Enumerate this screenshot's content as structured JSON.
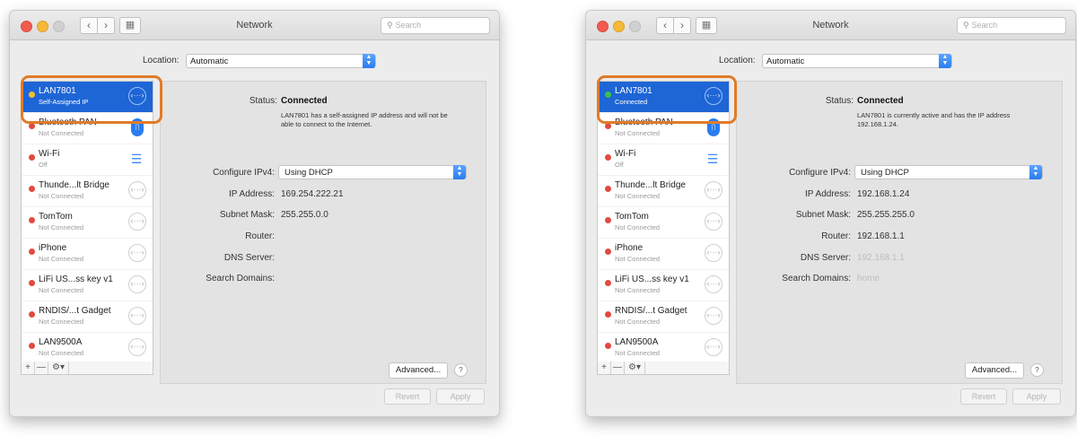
{
  "windows": [
    {
      "title": "Network",
      "search_placeholder": "Search",
      "location_label": "Location:",
      "location_value": "Automatic",
      "services": [
        {
          "name": "LAN7801",
          "status": "Self-Assigned IP",
          "dot": "yellow",
          "icon": "ethernet-icon"
        },
        {
          "name": "Bluetooth PAN",
          "status": "Not Connected",
          "dot": "red",
          "icon": "bluetooth-icon"
        },
        {
          "name": "Wi-Fi",
          "status": "Off",
          "dot": "red",
          "icon": "wifi-icon"
        },
        {
          "name": "Thunde...lt Bridge",
          "status": "Not Connected",
          "dot": "red",
          "icon": "ethernet-icon"
        },
        {
          "name": "TomTom",
          "status": "Not Connected",
          "dot": "red",
          "icon": "ethernet-icon"
        },
        {
          "name": "iPhone",
          "status": "Not Connected",
          "dot": "red",
          "icon": "ethernet-icon"
        },
        {
          "name": "LiFi US...ss key v1",
          "status": "Not Connected",
          "dot": "red",
          "icon": "ethernet-icon"
        },
        {
          "name": "RNDIS/...t Gadget",
          "status": "Not Connected",
          "dot": "red",
          "icon": "ethernet-icon"
        },
        {
          "name": "LAN9500A",
          "status": "Not Connected",
          "dot": "red",
          "icon": "ethernet-icon"
        }
      ],
      "status_label": "Status:",
      "status_value": "Connected",
      "status_message": "LAN7801 has a self-assigned IP address and will not be able to connect to the Internet.",
      "configure_label": "Configure IPv4:",
      "configure_value": "Using DHCP",
      "ip_label": "IP Address:",
      "ip_value": "169.254.222.21",
      "subnet_label": "Subnet Mask:",
      "subnet_value": "255.255.0.0",
      "router_label": "Router:",
      "router_value": "",
      "dns_label": "DNS Server:",
      "dns_value": "",
      "search_domains_label": "Search Domains:",
      "search_domains_value": "",
      "advanced_label": "Advanced...",
      "help_label": "?",
      "revert_label": "Revert",
      "apply_label": "Apply",
      "footer_plus": "+",
      "footer_minus": "—",
      "footer_gear": "⚙▾"
    },
    {
      "title": "Network",
      "search_placeholder": "Search",
      "location_label": "Location:",
      "location_value": "Automatic",
      "services": [
        {
          "name": "LAN7801",
          "status": "Connected",
          "dot": "green",
          "icon": "ethernet-icon"
        },
        {
          "name": "Bluetooth PAN",
          "status": "Not Connected",
          "dot": "red",
          "icon": "bluetooth-icon"
        },
        {
          "name": "Wi-Fi",
          "status": "Off",
          "dot": "red",
          "icon": "wifi-icon"
        },
        {
          "name": "Thunde...lt Bridge",
          "status": "Not Connected",
          "dot": "red",
          "icon": "ethernet-icon"
        },
        {
          "name": "TomTom",
          "status": "Not Connected",
          "dot": "red",
          "icon": "ethernet-icon"
        },
        {
          "name": "iPhone",
          "status": "Not Connected",
          "dot": "red",
          "icon": "ethernet-icon"
        },
        {
          "name": "LiFi US...ss key v1",
          "status": "Not Connected",
          "dot": "red",
          "icon": "ethernet-icon"
        },
        {
          "name": "RNDIS/...t Gadget",
          "status": "Not Connected",
          "dot": "red",
          "icon": "ethernet-icon"
        },
        {
          "name": "LAN9500A",
          "status": "Not Connected",
          "dot": "red",
          "icon": "ethernet-icon"
        }
      ],
      "status_label": "Status:",
      "status_value": "Connected",
      "status_message": "LAN7801 is currently active and has the IP address 192.168.1.24.",
      "configure_label": "Configure IPv4:",
      "configure_value": "Using DHCP",
      "ip_label": "IP Address:",
      "ip_value": "192.168.1.24",
      "subnet_label": "Subnet Mask:",
      "subnet_value": "255.255.255.0",
      "router_label": "Router:",
      "router_value": "192.168.1.1",
      "dns_label": "DNS Server:",
      "dns_value": "192.168.1.1",
      "search_domains_label": "Search Domains:",
      "search_domains_value": "home",
      "advanced_label": "Advanced...",
      "help_label": "?",
      "revert_label": "Revert",
      "apply_label": "Apply",
      "footer_plus": "+",
      "footer_minus": "—",
      "footer_gear": "⚙▾"
    }
  ],
  "colors": {
    "selection": "#1e65d6",
    "highlight": "#e07b28",
    "status_yellow": "#f0c030",
    "status_green": "#39c24a",
    "status_red": "#e14a3f"
  }
}
